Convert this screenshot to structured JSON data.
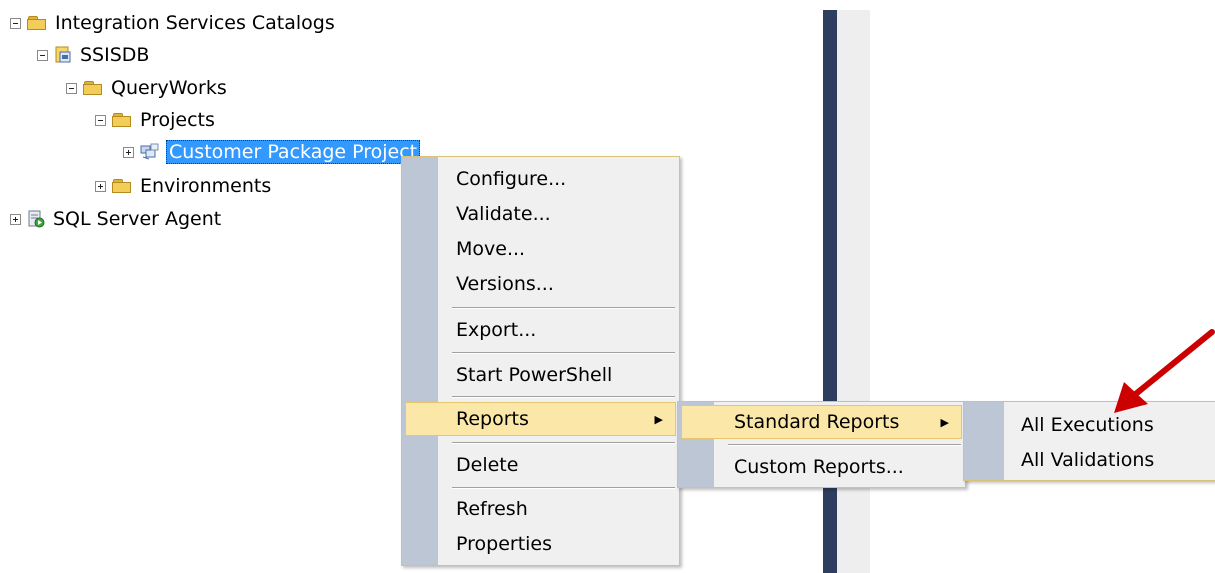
{
  "tree": {
    "root": "Integration Services Catalogs",
    "ssisdb": "SSISDB",
    "folder": "QueryWorks",
    "projects": "Projects",
    "selected_project": "Customer Package Project",
    "environments": "Environments",
    "agent": "SQL Server Agent"
  },
  "context_menu": {
    "items": [
      "Configure...",
      "Validate...",
      "Move...",
      "Versions...",
      "Export...",
      "Start PowerShell",
      "Reports",
      "Delete",
      "Refresh",
      "Properties"
    ],
    "highlighted": "Reports"
  },
  "reports_submenu": {
    "items": [
      "Standard Reports",
      "Custom Reports..."
    ],
    "highlighted": "Standard Reports"
  },
  "standard_reports_submenu": {
    "items": [
      "All Executions",
      "All Validations"
    ]
  },
  "colors": {
    "selection": "#3399ff",
    "menu_highlight": "#fbe7a8",
    "menu_gutter": "#bcc6d4",
    "annotation_arrow": "#cc0000"
  },
  "icons": {
    "folder": "folder-icon",
    "database": "catalog-database-icon",
    "project": "project-icon",
    "agent": "sql-agent-icon",
    "annotation": "red-arrow-icon"
  }
}
